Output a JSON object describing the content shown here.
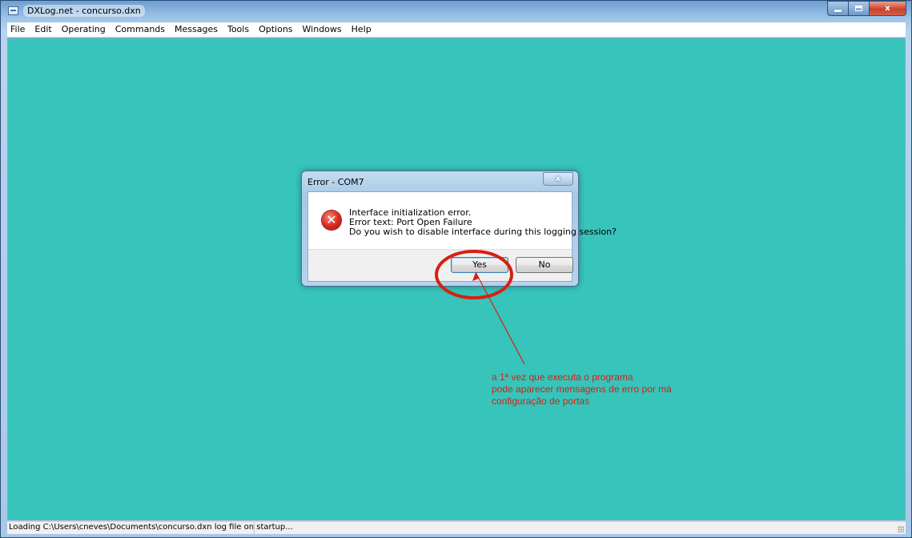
{
  "window": {
    "title": "DXLog.net - concurso.dxn",
    "caption_buttons": {
      "minimize": "–",
      "maximize": "□",
      "close": "x"
    },
    "client_color": "#37c4bb"
  },
  "menu": [
    "File",
    "Edit",
    "Operating",
    "Commands",
    "Messages",
    "Tools",
    "Options",
    "Windows",
    "Help"
  ],
  "dialog": {
    "title": "Error - COM7",
    "close_label": "x",
    "icon": "error-icon",
    "message_lines": [
      "Interface initialization error.",
      "Error text: Port Open Failure",
      "Do you wish to disable interface during this logging session?"
    ],
    "buttons": {
      "yes": "Yes",
      "no": "No"
    }
  },
  "annotation": {
    "color": "#d82010",
    "lines": [
      "a 1ª vez que executa o programa",
      "pode aparecer mensagens de erro por má",
      "configuração de portas"
    ]
  },
  "statusbar": {
    "text": "Loading C:\\Users\\cneves\\Documents\\concurso.dxn log file on startup..."
  }
}
